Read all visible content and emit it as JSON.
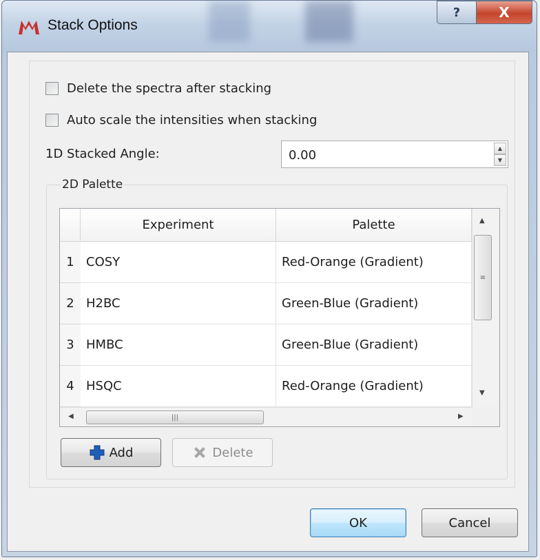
{
  "window": {
    "title": "Stack Options",
    "help_glyph": "?",
    "close_glyph": "X"
  },
  "options": {
    "delete_spectra": {
      "label": "Delete the spectra after stacking",
      "checked": false
    },
    "auto_scale": {
      "label": "Auto scale the intensities when stacking",
      "checked": false
    },
    "angle_label": "1D Stacked Angle:",
    "angle_value": "0.00"
  },
  "palette": {
    "group_label": "2D Palette",
    "columns": [
      "Experiment",
      "Palette"
    ],
    "rows": [
      {
        "num": "1",
        "experiment": "COSY",
        "palette": "Red-Orange (Gradient)"
      },
      {
        "num": "2",
        "experiment": "H2BC",
        "palette": "Green-Blue (Gradient)"
      },
      {
        "num": "3",
        "experiment": "HMBC",
        "palette": "Green-Blue (Gradient)"
      },
      {
        "num": "4",
        "experiment": "HSQC",
        "palette": "Red-Orange (Gradient)"
      }
    ],
    "add_label": "Add",
    "delete_label": "Delete"
  },
  "footer": {
    "ok_label": "OK",
    "cancel_label": "Cancel"
  },
  "colors": {
    "accent_blue": "#1f5fb8",
    "close_red": "#c5452d",
    "app_icon": "#c8302c"
  }
}
